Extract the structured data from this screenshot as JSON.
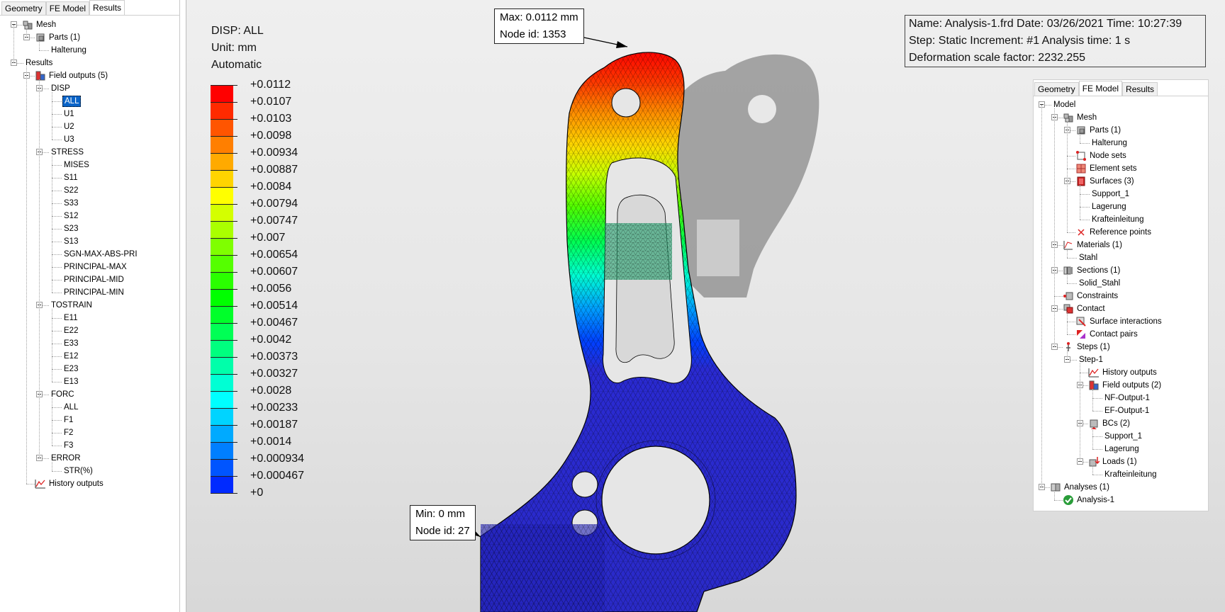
{
  "left_tabs": [
    "Geometry",
    "FE Model",
    "Results"
  ],
  "left_active_tab": 2,
  "left_tree": [
    {
      "label": "Mesh",
      "level": 0,
      "expander": true,
      "icon": "mesh-icon"
    },
    {
      "label": "Parts (1)",
      "level": 1,
      "expander": true,
      "icon": "parts-icon"
    },
    {
      "label": "Halterung",
      "level": 2,
      "expander": false,
      "icon": ""
    },
    {
      "label": "Results",
      "level": 0,
      "expander": true,
      "icon": ""
    },
    {
      "label": "Field outputs (5)",
      "level": 1,
      "expander": true,
      "icon": "field-outputs-icon"
    },
    {
      "label": "DISP",
      "level": 2,
      "expander": true,
      "icon": ""
    },
    {
      "label": "ALL",
      "level": 3,
      "expander": false,
      "icon": "",
      "selected": true
    },
    {
      "label": "U1",
      "level": 3,
      "expander": false,
      "icon": ""
    },
    {
      "label": "U2",
      "level": 3,
      "expander": false,
      "icon": ""
    },
    {
      "label": "U3",
      "level": 3,
      "expander": false,
      "icon": ""
    },
    {
      "label": "STRESS",
      "level": 2,
      "expander": true,
      "icon": ""
    },
    {
      "label": "MISES",
      "level": 3,
      "expander": false,
      "icon": ""
    },
    {
      "label": "S11",
      "level": 3,
      "expander": false,
      "icon": ""
    },
    {
      "label": "S22",
      "level": 3,
      "expander": false,
      "icon": ""
    },
    {
      "label": "S33",
      "level": 3,
      "expander": false,
      "icon": ""
    },
    {
      "label": "S12",
      "level": 3,
      "expander": false,
      "icon": ""
    },
    {
      "label": "S23",
      "level": 3,
      "expander": false,
      "icon": ""
    },
    {
      "label": "S13",
      "level": 3,
      "expander": false,
      "icon": ""
    },
    {
      "label": "SGN-MAX-ABS-PRI",
      "level": 3,
      "expander": false,
      "icon": ""
    },
    {
      "label": "PRINCIPAL-MAX",
      "level": 3,
      "expander": false,
      "icon": ""
    },
    {
      "label": "PRINCIPAL-MID",
      "level": 3,
      "expander": false,
      "icon": ""
    },
    {
      "label": "PRINCIPAL-MIN",
      "level": 3,
      "expander": false,
      "icon": ""
    },
    {
      "label": "TOSTRAIN",
      "level": 2,
      "expander": true,
      "icon": ""
    },
    {
      "label": "E11",
      "level": 3,
      "expander": false,
      "icon": ""
    },
    {
      "label": "E22",
      "level": 3,
      "expander": false,
      "icon": ""
    },
    {
      "label": "E33",
      "level": 3,
      "expander": false,
      "icon": ""
    },
    {
      "label": "E12",
      "level": 3,
      "expander": false,
      "icon": ""
    },
    {
      "label": "E23",
      "level": 3,
      "expander": false,
      "icon": ""
    },
    {
      "label": "E13",
      "level": 3,
      "expander": false,
      "icon": ""
    },
    {
      "label": "FORC",
      "level": 2,
      "expander": true,
      "icon": ""
    },
    {
      "label": "ALL",
      "level": 3,
      "expander": false,
      "icon": ""
    },
    {
      "label": "F1",
      "level": 3,
      "expander": false,
      "icon": ""
    },
    {
      "label": "F2",
      "level": 3,
      "expander": false,
      "icon": ""
    },
    {
      "label": "F3",
      "level": 3,
      "expander": false,
      "icon": ""
    },
    {
      "label": "ERROR",
      "level": 2,
      "expander": true,
      "icon": ""
    },
    {
      "label": "STR(%)",
      "level": 3,
      "expander": false,
      "icon": ""
    },
    {
      "label": "History outputs",
      "level": 1,
      "expander": false,
      "icon": "history-outputs-icon"
    }
  ],
  "legend": {
    "field": "DISP: ALL",
    "unit": "Unit: mm",
    "mode": "Automatic",
    "labels": [
      "+0.0112",
      "+0.0107",
      "+0.0103",
      "+0.0098",
      "+0.00934",
      "+0.00887",
      "+0.0084",
      "+0.00794",
      "+0.00747",
      "+0.007",
      "+0.00654",
      "+0.00607",
      "+0.0056",
      "+0.00514",
      "+0.00467",
      "+0.0042",
      "+0.00373",
      "+0.00327",
      "+0.0028",
      "+0.00233",
      "+0.00187",
      "+0.0014",
      "+0.000934",
      "+0.000467",
      "+0"
    ],
    "colors": [
      "#ff0000",
      "#ff2a00",
      "#ff5500",
      "#ff7f00",
      "#ffaa00",
      "#ffd400",
      "#ffff00",
      "#d4ff00",
      "#aaff00",
      "#7fff00",
      "#55ff00",
      "#2aff00",
      "#00ff00",
      "#00ff2a",
      "#00ff55",
      "#00ff7f",
      "#00ffaa",
      "#00ffd4",
      "#00ffff",
      "#00d4ff",
      "#00aaff",
      "#007fff",
      "#0055ff",
      "#002aff"
    ]
  },
  "callouts": {
    "max_line1": "Max: 0.0112 mm",
    "max_line2": "Node id: 1353",
    "min_line1": "Min: 0 mm",
    "min_line2": "Node id: 27"
  },
  "info": {
    "line1": "Name: Analysis-1.frd   Date: 03/26/2021   Time: 10:27:39",
    "line2": "Step: Static   Increment: #1   Analysis time: 1 s",
    "line3": "Deformation scale factor: 2232.255"
  },
  "right_tabs": [
    "Geometry",
    "FE Model",
    "Results"
  ],
  "right_active_tab": 1,
  "right_tree": [
    {
      "label": "Model",
      "level": 0,
      "expander": true,
      "icon": ""
    },
    {
      "label": "Mesh",
      "level": 1,
      "expander": true,
      "icon": "mesh-icon"
    },
    {
      "label": "Parts (1)",
      "level": 2,
      "expander": true,
      "icon": "parts-icon"
    },
    {
      "label": "Halterung",
      "level": 3,
      "expander": false,
      "icon": ""
    },
    {
      "label": "Node sets",
      "level": 2,
      "expander": false,
      "icon": "node-sets-icon"
    },
    {
      "label": "Element sets",
      "level": 2,
      "expander": false,
      "icon": "element-sets-icon"
    },
    {
      "label": "Surfaces (3)",
      "level": 2,
      "expander": true,
      "icon": "surfaces-icon"
    },
    {
      "label": "Support_1",
      "level": 3,
      "expander": false,
      "icon": ""
    },
    {
      "label": "Lagerung",
      "level": 3,
      "expander": false,
      "icon": ""
    },
    {
      "label": "Krafteinleitung",
      "level": 3,
      "expander": false,
      "icon": ""
    },
    {
      "label": "Reference points",
      "level": 2,
      "expander": false,
      "icon": "reference-points-icon"
    },
    {
      "label": "Materials (1)",
      "level": 1,
      "expander": true,
      "icon": "materials-icon"
    },
    {
      "label": "Stahl",
      "level": 2,
      "expander": false,
      "icon": ""
    },
    {
      "label": "Sections (1)",
      "level": 1,
      "expander": true,
      "icon": "sections-icon"
    },
    {
      "label": "Solid_Stahl",
      "level": 2,
      "expander": false,
      "icon": ""
    },
    {
      "label": "Constraints",
      "level": 1,
      "expander": false,
      "icon": "constraints-icon"
    },
    {
      "label": "Contact",
      "level": 1,
      "expander": true,
      "icon": "contact-icon"
    },
    {
      "label": "Surface interactions",
      "level": 2,
      "expander": false,
      "icon": "surface-interactions-icon"
    },
    {
      "label": "Contact pairs",
      "level": 2,
      "expander": false,
      "icon": "contact-pairs-icon"
    },
    {
      "label": "Steps (1)",
      "level": 1,
      "expander": true,
      "icon": "steps-icon"
    },
    {
      "label": "Step-1",
      "level": 2,
      "expander": true,
      "icon": ""
    },
    {
      "label": "History outputs",
      "level": 3,
      "expander": false,
      "icon": "history-outputs-icon"
    },
    {
      "label": "Field outputs (2)",
      "level": 3,
      "expander": true,
      "icon": "field-outputs-icon"
    },
    {
      "label": "NF-Output-1",
      "level": 4,
      "expander": false,
      "icon": ""
    },
    {
      "label": "EF-Output-1",
      "level": 4,
      "expander": false,
      "icon": ""
    },
    {
      "label": "BCs (2)",
      "level": 3,
      "expander": true,
      "icon": "bcs-icon"
    },
    {
      "label": "Support_1",
      "level": 4,
      "expander": false,
      "icon": ""
    },
    {
      "label": "Lagerung",
      "level": 4,
      "expander": false,
      "icon": ""
    },
    {
      "label": "Loads (1)",
      "level": 3,
      "expander": true,
      "icon": "loads-icon"
    },
    {
      "label": "Krafteinleitung",
      "level": 4,
      "expander": false,
      "icon": ""
    },
    {
      "label": "Analyses (1)",
      "level": 0,
      "expander": true,
      "icon": "analyses-icon"
    },
    {
      "label": "Analysis-1",
      "level": 1,
      "expander": false,
      "icon": "analysis-ok-icon"
    }
  ]
}
